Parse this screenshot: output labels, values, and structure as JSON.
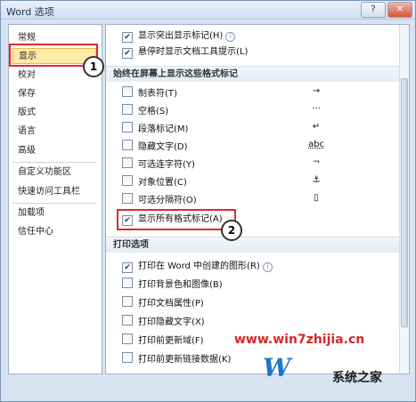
{
  "window": {
    "title": "Word 选项",
    "help_label": "?",
    "close_label": "✕"
  },
  "sidebar": {
    "items": [
      {
        "label": "常规"
      },
      {
        "label": "显示"
      },
      {
        "label": "校对"
      },
      {
        "label": "保存"
      },
      {
        "label": "版式"
      },
      {
        "label": "语言"
      },
      {
        "label": "高级"
      },
      {
        "label": "自定义功能区"
      },
      {
        "label": "快速访问工具栏"
      },
      {
        "label": "加载项"
      },
      {
        "label": "信任中心"
      }
    ],
    "active_index": 1
  },
  "callouts": {
    "one": "1",
    "two": "2"
  },
  "content": {
    "top_options": [
      {
        "label": "显示突出显示标记(H)",
        "checked": true,
        "info": true
      },
      {
        "label": "悬停时显示文档工具提示(L)",
        "checked": true,
        "info": false
      }
    ],
    "format_marks_header": "始终在屏幕上显示这些格式标记",
    "format_marks": [
      {
        "label": "制表符(T)",
        "checked": false,
        "mark": "→"
      },
      {
        "label": "空格(S)",
        "checked": false,
        "mark": "···"
      },
      {
        "label": "段落标记(M)",
        "checked": false,
        "mark": "↵"
      },
      {
        "label": "隐藏文字(D)",
        "checked": false,
        "mark": "abc"
      },
      {
        "label": "可选连字符(Y)",
        "checked": false,
        "mark": "¬"
      },
      {
        "label": "对象位置(C)",
        "checked": false,
        "mark": "⚓"
      },
      {
        "label": "可选分隔符(O)",
        "checked": false,
        "mark": "▯"
      },
      {
        "label": "显示所有格式标记(A)",
        "checked": true,
        "mark": ""
      }
    ],
    "print_header": "打印选项",
    "print_options": [
      {
        "label": "打印在 Word 中创建的图形(R)",
        "checked": true,
        "info": true
      },
      {
        "label": "打印背景色和图像(B)",
        "checked": false,
        "info": false
      },
      {
        "label": "打印文档属性(P)",
        "checked": false,
        "info": false
      },
      {
        "label": "打印隐藏文字(X)",
        "checked": false,
        "info": false
      },
      {
        "label": "打印前更新域(F)",
        "checked": false,
        "info": false
      },
      {
        "label": "打印前更新链接数据(K)",
        "checked": false,
        "info": false
      }
    ]
  },
  "watermark": {
    "url": "www.win7zhijia.cn",
    "logo_letter": "W",
    "logo_text": "系统之家"
  }
}
